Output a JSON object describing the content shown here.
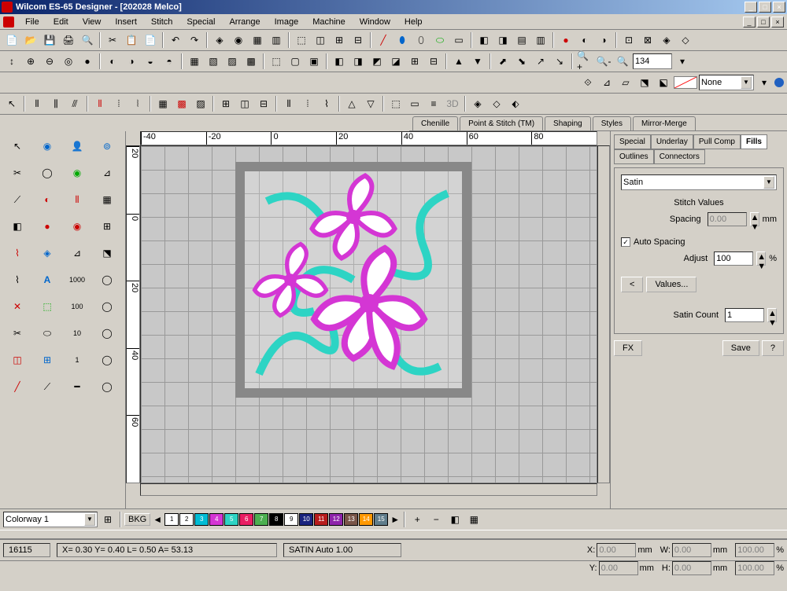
{
  "title": "Wilcom ES-65 Designer - [202028     Melco]",
  "menu": [
    "File",
    "Edit",
    "View",
    "Insert",
    "Stitch",
    "Special",
    "Arrange",
    "Image",
    "Machine",
    "Window",
    "Help"
  ],
  "zoom_value": "134",
  "fill_dropdown": "None",
  "prop_tabs_top": [
    "Chenille",
    "Point & Stitch (TM)",
    "Shaping",
    "Styles",
    "Mirror-Merge"
  ],
  "panel": {
    "tabs_row1": [
      "Special",
      "Underlay",
      "Pull Comp"
    ],
    "tabs_row2": [
      "Fills",
      "Outlines",
      "Connectors"
    ],
    "active_tab": "Fills",
    "fill_type": "Satin",
    "stitch_values_label": "Stitch Values",
    "spacing_label": "Spacing",
    "spacing_value": "0.00",
    "spacing_unit": "mm",
    "auto_spacing_label": "Auto Spacing",
    "auto_spacing_checked": true,
    "adjust_label": "Adjust",
    "adjust_value": "100",
    "adjust_unit": "%",
    "values_btn": "Values...",
    "values_nav": "<",
    "satin_count_label": "Satin Count",
    "satin_count_value": "1",
    "fx_btn": "FX",
    "save_btn": "Save",
    "help_btn": "?"
  },
  "colorway": "Colorway 1",
  "bkg_label": "BKG",
  "colors": [
    {
      "n": "1",
      "c": "#ffffff"
    },
    {
      "n": "2",
      "c": "#ffffff"
    },
    {
      "n": "3",
      "c": "#00bcd4"
    },
    {
      "n": "4",
      "c": "#d436d4"
    },
    {
      "n": "5",
      "c": "#2dd4c4"
    },
    {
      "n": "6",
      "c": "#e91e63"
    },
    {
      "n": "7",
      "c": "#4caf50"
    },
    {
      "n": "8",
      "c": "#000000"
    },
    {
      "n": "9",
      "c": "#ffffff"
    },
    {
      "n": "10",
      "c": "#1a237e"
    },
    {
      "n": "11",
      "c": "#b71c1c"
    },
    {
      "n": "12",
      "c": "#8e24aa"
    },
    {
      "n": "13",
      "c": "#795548"
    },
    {
      "n": "14",
      "c": "#ff9800"
    },
    {
      "n": "15",
      "c": "#607d8b"
    }
  ],
  "status": {
    "stitches": "16115",
    "coords": "X=   0.30 Y=   0.40 L=   0.50 A=   53.13",
    "stitch_type": "SATIN Auto  1.00",
    "x_label": "X:",
    "x_val": "0.00",
    "x_unit": "mm",
    "y_label": "Y:",
    "y_val": "0.00",
    "y_unit": "mm",
    "w_label": "W:",
    "w_val": "0.00",
    "w_unit": "mm",
    "h_label": "H:",
    "h_val": "0.00",
    "h_unit": "mm",
    "wp_val": "100.00",
    "wp_unit": "%",
    "hp_val": "100.00",
    "hp_unit": "%"
  },
  "ruler_h": [
    "-40",
    "-20",
    "0",
    "20",
    "40",
    "60",
    "80"
  ],
  "ruler_v": [
    "20",
    "0",
    "20",
    "40",
    "60"
  ]
}
